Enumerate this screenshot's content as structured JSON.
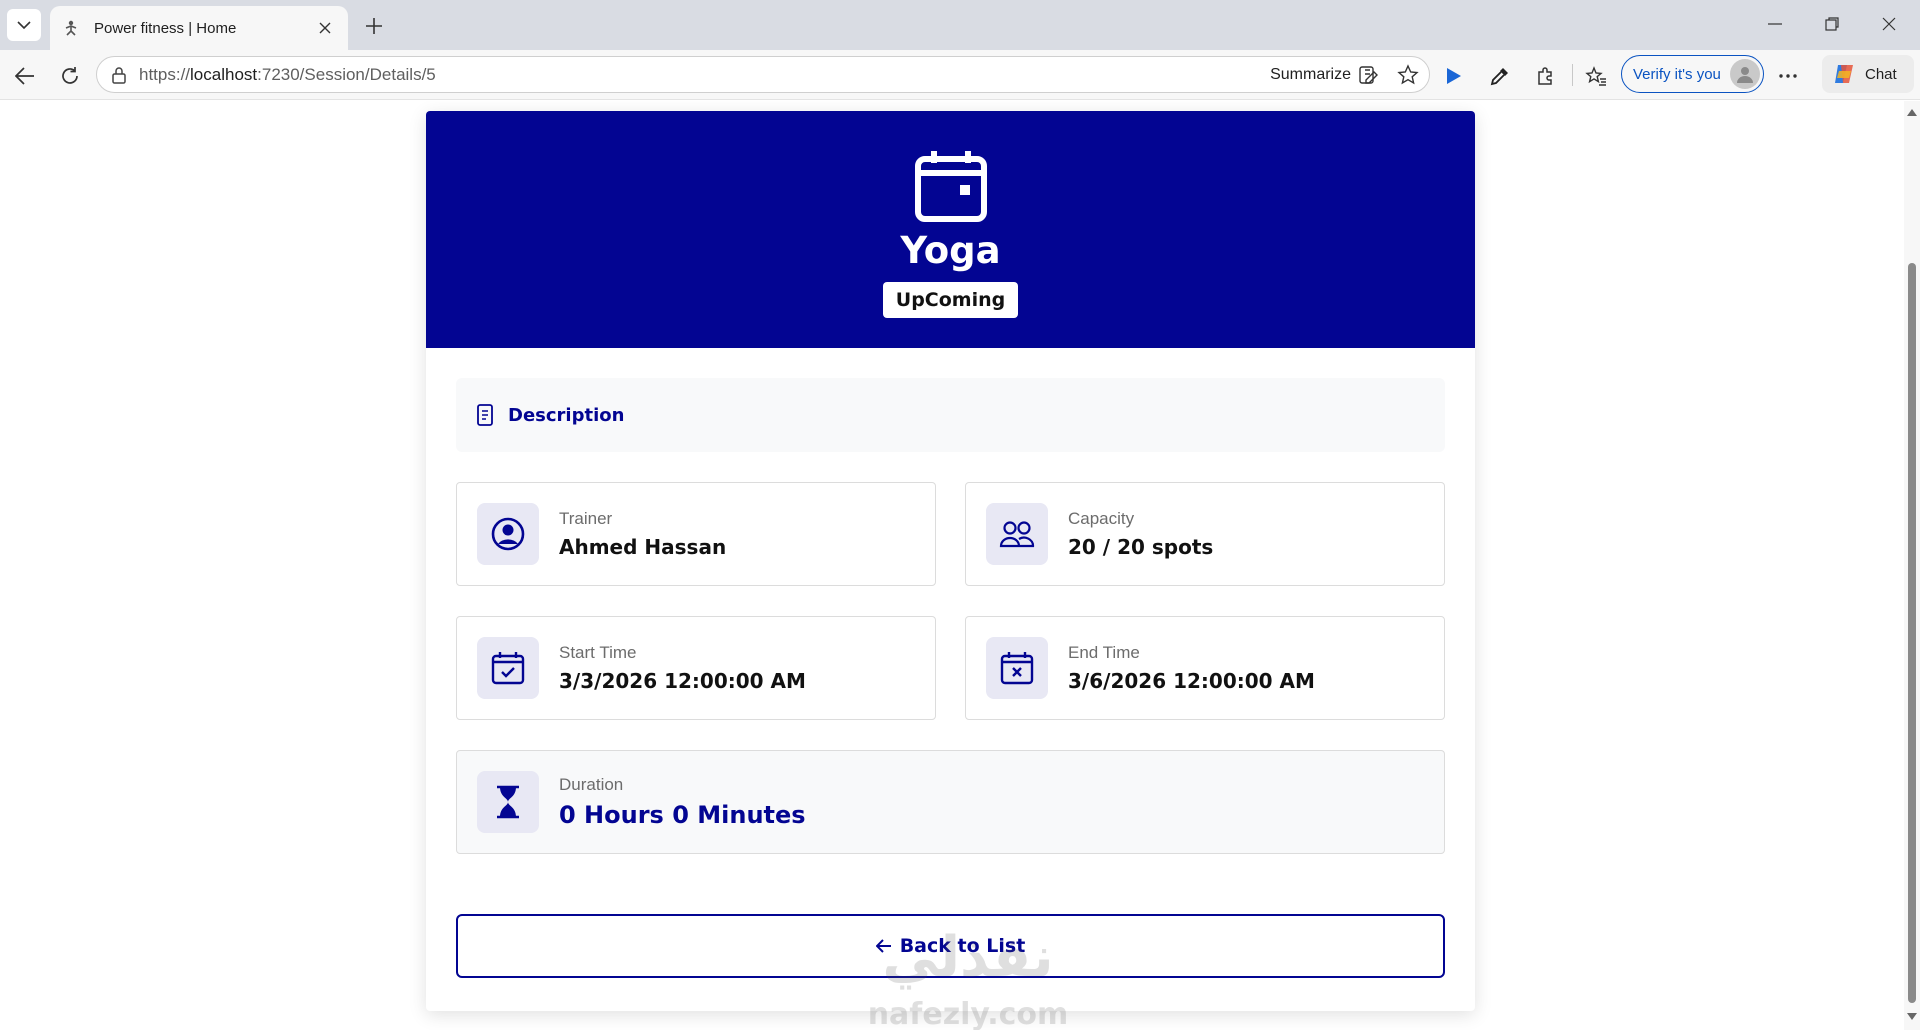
{
  "browser": {
    "tab_title": "Power fitness | Home",
    "url_prefix": "https://",
    "url_host": "localhost",
    "url_path": ":7230/Session/Details/5",
    "summarize_label": "Summarize",
    "verify_label": "Verify it's you",
    "chat_label": "Chat"
  },
  "session": {
    "title": "Yoga",
    "status": "UpComing",
    "description_label": "Description",
    "trainer": {
      "label": "Trainer",
      "value": "Ahmed Hassan"
    },
    "capacity": {
      "label": "Capacity",
      "value": "20 / 20 spots"
    },
    "start": {
      "label": "Start Time",
      "value": "3/3/2026 12:00:00 AM"
    },
    "end": {
      "label": "End Time",
      "value": "3/6/2026 12:00:00 AM"
    },
    "duration": {
      "label": "Duration",
      "value": "0 Hours 0 Minutes"
    },
    "back_label": "Back to List"
  },
  "watermark": {
    "text": "نفذلي",
    "subtext": "nafezly.com"
  },
  "colors": {
    "primary": "#030592",
    "icon_bg": "#e8e8f4"
  }
}
